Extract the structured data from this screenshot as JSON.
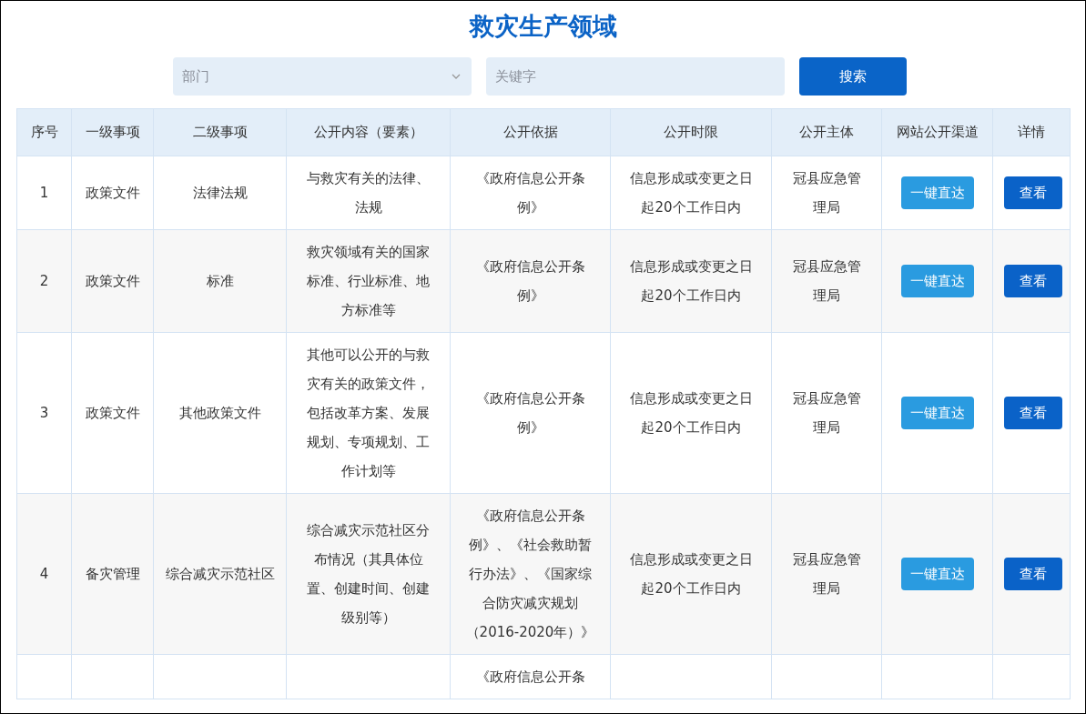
{
  "title": "救灾生产领域",
  "filters": {
    "department": {
      "placeholder": "部门"
    },
    "keyword": {
      "placeholder": "关键字"
    },
    "search_button": "搜索"
  },
  "table": {
    "columns": [
      "序号",
      "一级事项",
      "二级事项",
      "公开内容（要素）",
      "公开依据",
      "公开时限",
      "公开主体",
      "网站公开渠道",
      "详情"
    ],
    "rows": [
      {
        "index": "1",
        "level1": "政策文件",
        "level2": "法律法规",
        "content": "与救灾有关的法律、法规",
        "basis": "《政府信息公开条例》",
        "time_limit": "信息形成或变更之日起20个工作日内",
        "subject": "冠县应急管理局",
        "channel_button": "一键直达",
        "detail_button": "查看"
      },
      {
        "index": "2",
        "level1": "政策文件",
        "level2": "标准",
        "content": "救灾领域有关的国家标准、行业标准、地方标准等",
        "basis": "《政府信息公开条例》",
        "time_limit": "信息形成或变更之日起20个工作日内",
        "subject": "冠县应急管理局",
        "channel_button": "一键直达",
        "detail_button": "查看"
      },
      {
        "index": "3",
        "level1": "政策文件",
        "level2": "其他政策文件",
        "content": "其他可以公开的与救灾有关的政策文件，包括改革方案、发展规划、专项规划、工作计划等",
        "basis": "《政府信息公开条例》",
        "time_limit": "信息形成或变更之日起20个工作日内",
        "subject": "冠县应急管理局",
        "channel_button": "一键直达",
        "detail_button": "查看"
      },
      {
        "index": "4",
        "level1": "备灾管理",
        "level2": "综合减灾示范社区",
        "content": "综合减灾示范社区分布情况（其具体位置、创建时间、创建级别等）",
        "basis": "《政府信息公开条例》、《社会救助暂行办法》、《国家综合防灾减灾规划（2016-2020年）》",
        "time_limit": "信息形成或变更之日起20个工作日内",
        "subject": "冠县应急管理局",
        "channel_button": "一键直达",
        "detail_button": "查看"
      },
      {
        "basis": "《政府信息公开条"
      }
    ]
  }
}
